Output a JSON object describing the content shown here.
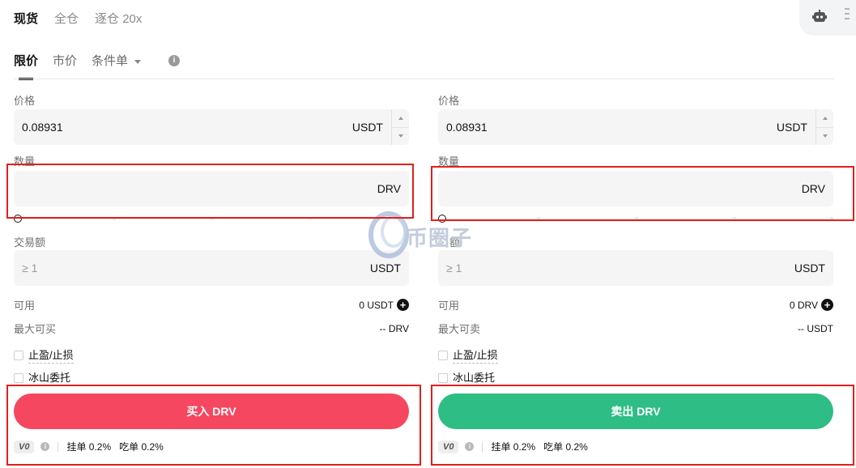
{
  "mode_tabs": [
    {
      "label": "现货",
      "active": true
    },
    {
      "label": "全仓",
      "active": false
    },
    {
      "label": "逐仓 20x",
      "active": false
    }
  ],
  "order_tabs": {
    "limit": "限价",
    "market": "市价",
    "conditional": "条件单"
  },
  "icons": {
    "bot": "robot-icon",
    "info": "info-icon",
    "plus": "plus-circle-icon"
  },
  "colors": {
    "buy": "#f5475f",
    "sell": "#2ebd85",
    "highlight": "#e0201f"
  },
  "buy": {
    "price_label": "价格",
    "price_value": "0.08931",
    "price_unit": "USDT",
    "qty_label": "数量",
    "qty_value": "",
    "qty_unit": "DRV",
    "amount_label": "交易额",
    "amount_placeholder": "≥ 1",
    "amount_unit": "USDT",
    "available_label": "可用",
    "available_value": "0 USDT",
    "max_label": "最大可买",
    "max_value": "-- DRV",
    "tpsl_label": "止盈/止损",
    "iceberg_label": "冰山委托",
    "action_label": "买入 DRV",
    "vip": "V0",
    "maker_fee": "挂单 0.2%",
    "taker_fee": "吃单 0.2%"
  },
  "sell": {
    "price_label": "价格",
    "price_value": "0.08931",
    "price_unit": "USDT",
    "qty_label": "数量",
    "qty_value": "",
    "qty_unit": "DRV",
    "amount_label": "额",
    "amount_placeholder": "≥ 1",
    "amount_unit": "USDT",
    "available_label": "可用",
    "available_value": "0 DRV",
    "max_label": "最大可卖",
    "max_value": "-- USDT",
    "tpsl_label": "止盈/止损",
    "iceberg_label": "冰山委托",
    "action_label": "卖出 DRV",
    "vip": "V0",
    "maker_fee": "挂单 0.2%",
    "taker_fee": "吃单 0.2%"
  },
  "watermark": {
    "text": "币圈子"
  }
}
